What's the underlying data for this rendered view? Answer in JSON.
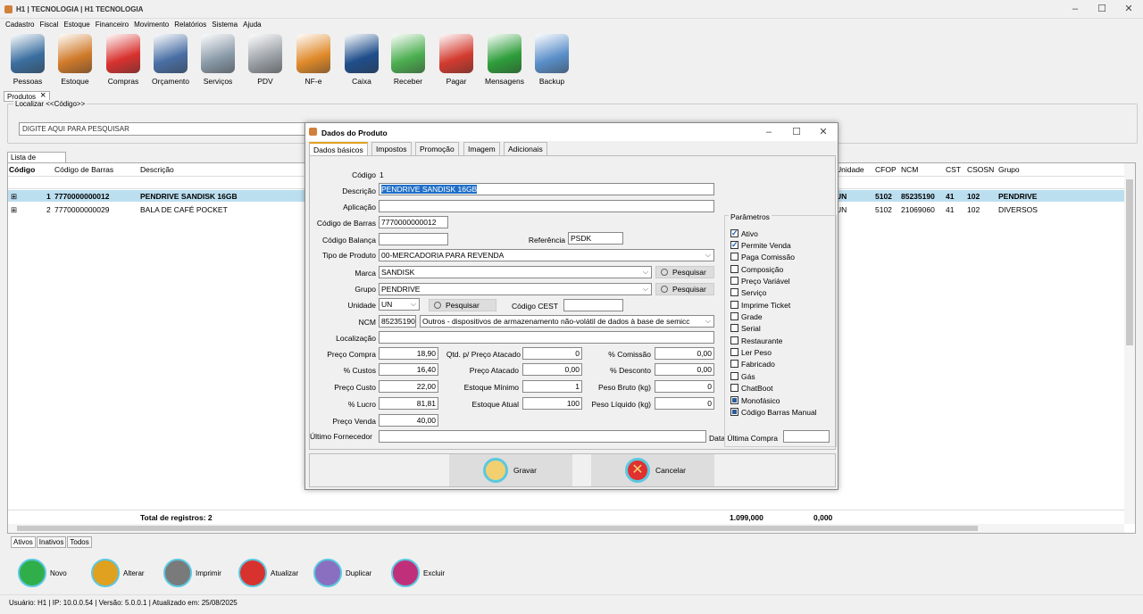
{
  "app": {
    "title": "H1 | TECNOLOGIA | H1 TECNOLOGIA"
  },
  "menu": [
    "Cadastro",
    "Fiscal",
    "Estoque",
    "Financeiro",
    "Movimento",
    "Relatórios",
    "Sistema",
    "Ajuda"
  ],
  "toolbar": [
    {
      "label": "Pessoas",
      "color": "#3b6fa0"
    },
    {
      "label": "Estoque",
      "color": "#d07a2a"
    },
    {
      "label": "Compras",
      "color": "#d8322f"
    },
    {
      "label": "Orçamento",
      "color": "#4a6fa5"
    },
    {
      "label": "Serviços",
      "color": "#8a9aa8"
    },
    {
      "label": "PDV",
      "color": "#9aa0a6"
    },
    {
      "label": "NF-e",
      "color": "#e08a2a"
    },
    {
      "label": "Caixa",
      "color": "#1f4e8c"
    },
    {
      "label": "Receber",
      "color": "#4caf50"
    },
    {
      "label": "Pagar",
      "color": "#d33b2f"
    },
    {
      "label": "Mensagens",
      "color": "#2e9e3a"
    },
    {
      "label": "Backup",
      "color": "#5a8fc9"
    }
  ],
  "doc_tab": "Produtos",
  "search": {
    "legend": "Localizar <<Código>>",
    "placeholder": "DIGITE AQUI PARA PESQUISAR"
  },
  "list": {
    "tab": "Lista de Produtos",
    "headers": {
      "codigo": "Código",
      "barras": "Código de Barras",
      "descricao": "Descrição",
      "unidade": "Unidade",
      "cfop": "CFOP",
      "ncm": "NCM",
      "cst": "CST",
      "csosn": "CSOSN",
      "grupo": "Grupo"
    },
    "rows": [
      {
        "codigo": "1",
        "barras": "7770000000012",
        "descricao": "PENDRIVE SANDISK 16GB",
        "unidade": "UN",
        "cfop": "5102",
        "ncm": "85235190",
        "cst": "41",
        "csosn": "102",
        "grupo": "PENDRIVE"
      },
      {
        "codigo": "2",
        "barras": "7770000000029",
        "descricao": "BALA DE CAFÉ POCKET",
        "unidade": "UN",
        "cfop": "5102",
        "ncm": "21069060",
        "cst": "41",
        "csosn": "102",
        "grupo": "DIVERSOS"
      }
    ],
    "footer": {
      "total": "Total de registros: 2",
      "sum1": "1.099,000",
      "sum2": "0,000"
    }
  },
  "bottom_tabs": [
    "Ativos",
    "Inativos",
    "Todos"
  ],
  "actions": [
    {
      "label": "Novo",
      "color": "#2fae4a"
    },
    {
      "label": "Alterar",
      "color": "#e0a020"
    },
    {
      "label": "Imprimir",
      "color": "#7a7a7a"
    },
    {
      "label": "Atualizar",
      "color": "#d8322f"
    },
    {
      "label": "Duplicar",
      "color": "#8a6fc0"
    },
    {
      "label": "Excluir",
      "color": "#c0307a"
    }
  ],
  "status": "Usuário: H1 | IP: 10.0.0.54 | Versão: 5.0.0.1 | Atualizado em: 25/08/2025",
  "dialog": {
    "title": "Dados do Produto",
    "tabs": [
      "Dados básicos",
      "Impostos",
      "Promoção",
      "Imagem",
      "Adicionais"
    ],
    "labels": {
      "codigo": "Código",
      "descricao": "Descrição",
      "aplicacao": "Aplicação",
      "barras": "Código de Barras",
      "balanca": "Código Balança",
      "referencia": "Referência",
      "tipo": "Tipo de Produto",
      "marca": "Marca",
      "grupo": "Grupo",
      "unidade": "Unidade",
      "cest": "Código CEST",
      "ncm": "NCM",
      "localizacao": "Localização",
      "preco_compra": "Preço Compra",
      "custos": "% Custos",
      "preco_custo": "Preço Custo",
      "lucro": "% Lucro",
      "preco_venda": "Preço Venda",
      "qtd_atacado": "Qtd. p/ Preço Atacado",
      "preco_atacado": "Preço Atacado",
      "estoque_min": "Estoque Mínimo",
      "estoque_atual": "Estoque Atual",
      "comissao": "% Comissão",
      "desconto": "% Desconto",
      "peso_bruto": "Peso Bruto (kg)",
      "peso_liquido": "Peso Líquido (kg)",
      "ultimo_fornecedor": "Último Fornecedor",
      "data_compra": "Data Última Compra",
      "pesquisar": "Pesquisar"
    },
    "values": {
      "codigo": "1",
      "descricao": "PENDRIVE SANDISK 16GB",
      "aplicacao": "",
      "barras": "7770000000012",
      "balanca": "",
      "referencia": "PSDK",
      "tipo": "00-MERCADORIA PARA REVENDA",
      "marca": "SANDISK",
      "grupo": "PENDRIVE",
      "unidade": "UN",
      "cest": "",
      "ncm": "85235190",
      "ncm_desc": "Outros - dispositivos de armazenamento não-volátil de dados à base de semicc",
      "localizacao": "",
      "preco_compra": "18,90",
      "custos": "16,40",
      "preco_custo": "22,00",
      "lucro": "81,81",
      "preco_venda": "40,00",
      "qtd_atacado": "0",
      "preco_atacado": "0,00",
      "estoque_min": "1",
      "estoque_atual": "100",
      "comissao": "0,00",
      "desconto": "0,00",
      "peso_bruto": "0",
      "peso_liquido": "0",
      "ultimo_fornecedor": "",
      "data_compra": ""
    },
    "params_title": "Parâmetros",
    "params": [
      {
        "label": "Ativo",
        "state": "on"
      },
      {
        "label": "Permite Venda",
        "state": "on"
      },
      {
        "label": "Paga Comissão",
        "state": "off"
      },
      {
        "label": "Composição",
        "state": "off"
      },
      {
        "label": "Preço Variável",
        "state": "off"
      },
      {
        "label": "Serviço",
        "state": "off"
      },
      {
        "label": "Imprime Ticket",
        "state": "off"
      },
      {
        "label": "Grade",
        "state": "off"
      },
      {
        "label": "Serial",
        "state": "off"
      },
      {
        "label": "Restaurante",
        "state": "off"
      },
      {
        "label": "Ler Peso",
        "state": "off"
      },
      {
        "label": "Fabricado",
        "state": "off"
      },
      {
        "label": "Gás",
        "state": "off"
      },
      {
        "label": "ChatBoot",
        "state": "off"
      },
      {
        "label": "Monofásico",
        "state": "indeterminate"
      },
      {
        "label": "Código Barras Manual",
        "state": "indeterminate"
      }
    ],
    "buttons": {
      "save": "Gravar",
      "cancel": "Cancelar"
    }
  }
}
